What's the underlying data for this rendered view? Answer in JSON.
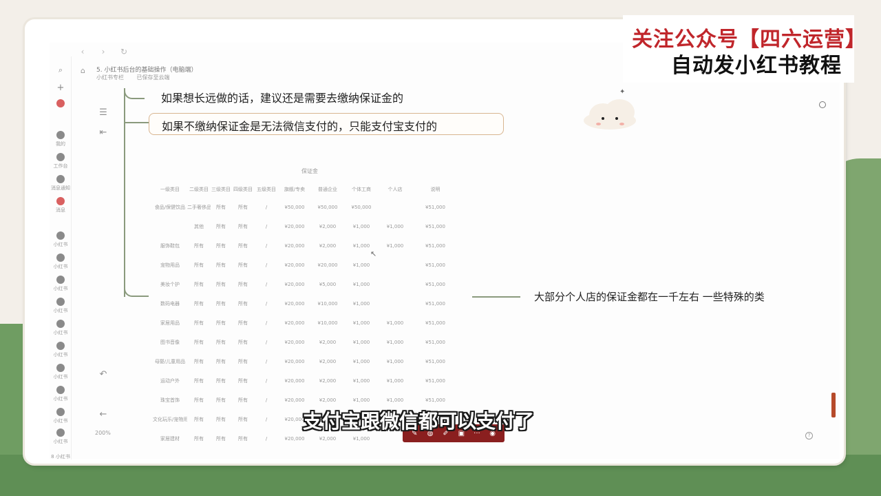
{
  "overlay": {
    "line1": "关注公众号【四六运营】",
    "line2": "自动发小红书教程"
  },
  "browser": {
    "back": "‹",
    "forward": "›",
    "reload": "↻"
  },
  "doc": {
    "title": "5. 小红书后台的基础操作（电脑端）",
    "breadcrumb": [
      "小红书专栏",
      "已保存至云端"
    ]
  },
  "mindmap": {
    "node1": "如果想长远做的话，建议还是需要去缴纳保证金的",
    "node2": "如果不缴纳保证金是无法微信支付的，只能支付宝支付的",
    "node3": "大部分个人店的保证金都在一千左右 一些特殊的类"
  },
  "table": {
    "title": "保证金",
    "headers": [
      "一级类目",
      "二级类目",
      "三级类目",
      "四级类目",
      "五级类目",
      "旗舰/专卖",
      "普通企业",
      "个体工商",
      "个人店",
      "说明"
    ],
    "rows": [
      [
        "食品/保健饮品",
        "二手奢侈品",
        "所有",
        "所有",
        "/",
        "¥50,000",
        "¥50,000",
        "¥50,000",
        "",
        "¥51,000"
      ],
      [
        "",
        "其他",
        "所有",
        "所有",
        "/",
        "¥20,000",
        "¥2,000",
        "¥1,000",
        "¥1,000",
        "¥51,000"
      ],
      [
        "服饰鞋包",
        "所有",
        "所有",
        "所有",
        "/",
        "¥20,000",
        "¥2,000",
        "¥1,000",
        "¥1,000",
        "¥51,000"
      ],
      [
        "宠物用品",
        "所有",
        "所有",
        "所有",
        "/",
        "¥20,000",
        "¥20,000",
        "¥1,000",
        "",
        "¥51,000"
      ],
      [
        "美妆个护",
        "所有",
        "所有",
        "所有",
        "/",
        "¥20,000",
        "¥5,000",
        "¥1,000",
        "",
        "¥51,000"
      ],
      [
        "数码电器",
        "所有",
        "所有",
        "所有",
        "/",
        "¥20,000",
        "¥10,000",
        "¥1,000",
        "",
        "¥51,000"
      ],
      [
        "家居用品",
        "所有",
        "所有",
        "所有",
        "/",
        "¥20,000",
        "¥10,000",
        "¥1,000",
        "¥1,000",
        "¥51,000"
      ],
      [
        "图书音像",
        "所有",
        "所有",
        "所有",
        "/",
        "¥20,000",
        "¥2,000",
        "¥1,000",
        "¥1,000",
        "¥51,000"
      ],
      [
        "母婴/儿童用品",
        "所有",
        "所有",
        "所有",
        "/",
        "¥20,000",
        "¥2,000",
        "¥1,000",
        "¥1,000",
        "¥51,000"
      ],
      [
        "运动户外",
        "所有",
        "所有",
        "所有",
        "/",
        "¥20,000",
        "¥2,000",
        "¥1,000",
        "¥1,000",
        "¥51,000"
      ],
      [
        "珠宝首饰",
        "所有",
        "所有",
        "所有",
        "/",
        "¥20,000",
        "¥2,000",
        "¥1,000",
        "¥1,000",
        "¥51,000"
      ],
      [
        "文化玩乐/宠物用品",
        "所有",
        "所有",
        "所有",
        "/",
        "¥20,000",
        "¥2,000",
        "¥1,000",
        "¥1,000",
        "¥51,000"
      ],
      [
        "家居建材",
        "所有",
        "所有",
        "所有",
        "/",
        "¥20,000",
        "¥2,000",
        "¥1,000",
        "",
        ""
      ]
    ]
  },
  "rail": {
    "items": [
      "我的",
      "工作台",
      "消息通知",
      "消息",
      "小红书",
      "小红书",
      "小红书",
      "小红书",
      "小红书",
      "小红书",
      "小红书",
      "小红书",
      "小红书",
      "小红书"
    ],
    "bottom": "8 小红书"
  },
  "zoom": "200%",
  "caption": "支付宝跟微信都可以支付了",
  "toolbar": {
    "icons": [
      "pen-icon",
      "eraser-icon",
      "brush-icon",
      "image-icon",
      "more-icon",
      "record-icon"
    ],
    "more": "···"
  },
  "colors": {
    "overlay_red": "#c0262b",
    "toolbar_bg": "#8a1f1f",
    "node_border": "#d8b590",
    "line": "#8a9a7d"
  }
}
